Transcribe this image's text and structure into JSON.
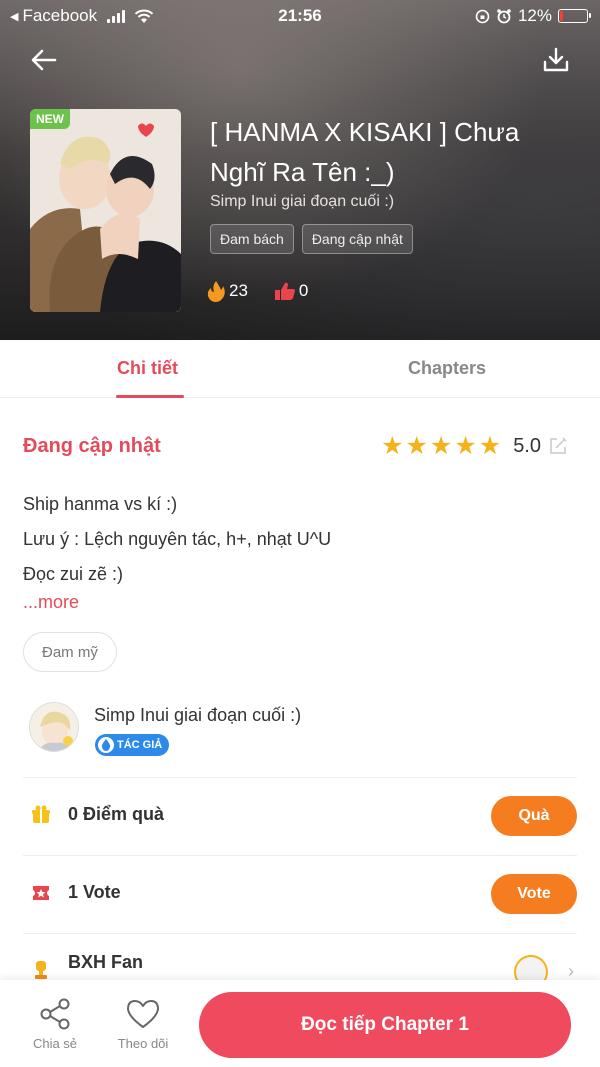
{
  "status_bar": {
    "app": "Facebook",
    "time": "21:56",
    "battery": "12%",
    "battery_level": 0.12
  },
  "header": {
    "badge": "NEW",
    "title": "[ HANMA X KISAKI ] Chưa Nghĩ Ra Tên :_)",
    "author": "Simp Inui giai đoạn cuối :)",
    "tags": [
      "Đam bách",
      "Đang cập nhật"
    ],
    "likes": "23",
    "dislikes": "0"
  },
  "tabs": [
    {
      "label": "Chi tiết",
      "active": true
    },
    {
      "label": "Chapters",
      "active": false
    }
  ],
  "details": {
    "status": "Đang cập nhật",
    "rating": "5.0",
    "stars": 5,
    "description": [
      "Ship hanma vs kí :)",
      "Lưu ý : Lệch nguyên tác, h+, nhạt U^U",
      "Đọc zui zẽ :)"
    ],
    "more": "...more",
    "genre": "Đam mỹ"
  },
  "author_card": {
    "name": "Simp Inui giai đoạn cuối :)",
    "badge": "TÁC GIẢ"
  },
  "gifts": {
    "label": "0 Điểm quà",
    "button": "Quà"
  },
  "votes": {
    "label": "1 Vote",
    "button": "Vote"
  },
  "fan_rank": {
    "label": "BXH Fan"
  },
  "bottom_bar": {
    "share": "Chia sẻ",
    "follow": "Theo dõi",
    "read": "Đọc tiếp Chapter 1"
  },
  "colors": {
    "accent": "#e64a5a",
    "orange": "#f57d1f",
    "star": "#f5b21a",
    "badge_blue": "#2d8ae8"
  }
}
